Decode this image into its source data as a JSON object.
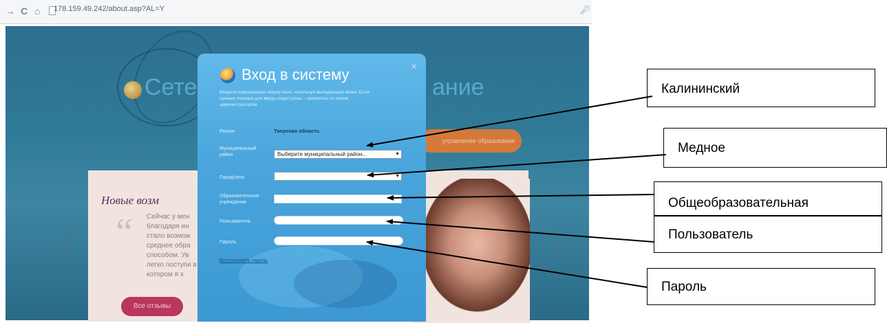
{
  "browser": {
    "back": "→",
    "reload": "C",
    "home": "⌂",
    "url": "178.159.49.242/about.asp?AL=Y"
  },
  "site": {
    "brand_left": "Сете",
    "brand_right": "ание",
    "orange_button": "управление образования",
    "panel_title": "Новые возм",
    "quote_mark": "“",
    "testimonial": "Сейчас у мен благодаря ин стало возмож среднее обра способом. Ув легко поступи в котором я х",
    "reviews_button": "Все отзывы"
  },
  "modal": {
    "title": "Вход в систему",
    "description": "Введите информацию сверху вниз, используя выпадающие меню. Если нужные позиции для ввода недоступны – свяжитесь со своим администратором.",
    "close": "×",
    "labels": {
      "region": "Регион",
      "municipal": "Муниципальный район",
      "city": "Город/село",
      "school": "Образовательное учреждение",
      "user": "Пользователь",
      "password": "Пароль"
    },
    "region_value": "Тверская область",
    "municipal_select": "Выберите муниципальный район...",
    "city_select": "",
    "school_select": "",
    "user_value": "",
    "password_value": "",
    "restore_link": "Восстановить пароль"
  },
  "callouts": {
    "kalininsky": "Калининский",
    "mednoe": "Медное",
    "school": "Общеобразовательная",
    "user": "Пользователь",
    "password": "Пароль"
  },
  "icons": [
    "back-arrow-icon",
    "reload-icon",
    "home-icon",
    "page-icon",
    "key-icon",
    "globe-icon",
    "close-icon",
    "select-arrow-icon",
    "chevron-left-icon",
    "chevron-right-icon"
  ]
}
